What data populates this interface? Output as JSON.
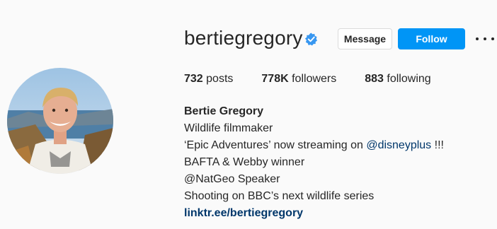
{
  "profile": {
    "username": "bertiegregory",
    "verified": true,
    "avatar_alt": "profile-photo",
    "actions": {
      "message_label": "Message",
      "follow_label": "Follow",
      "more_icon": "more-options-icon"
    },
    "stats": {
      "posts_count": "732",
      "posts_label": "posts",
      "followers_count": "778K",
      "followers_label": "followers",
      "following_count": "883",
      "following_label": "following"
    },
    "bio": {
      "full_name": "Bertie Gregory",
      "line1": "Wildlife filmmaker",
      "line2_prefix": "‘Epic Adventures’ now streaming on ",
      "line2_mention": "@disneyplus",
      "line2_suffix": " !!!",
      "line3": "BAFTA & Webby winner",
      "line4": "@NatGeo Speaker",
      "line5": "Shooting on BBC’s next wildlife series",
      "link": "linktr.ee/bertiegregory"
    }
  },
  "colors": {
    "background": "#fafafa",
    "text": "#262626",
    "follow_button": "#0095f6",
    "verified_badge": "#3897f0",
    "link": "#00376b"
  }
}
